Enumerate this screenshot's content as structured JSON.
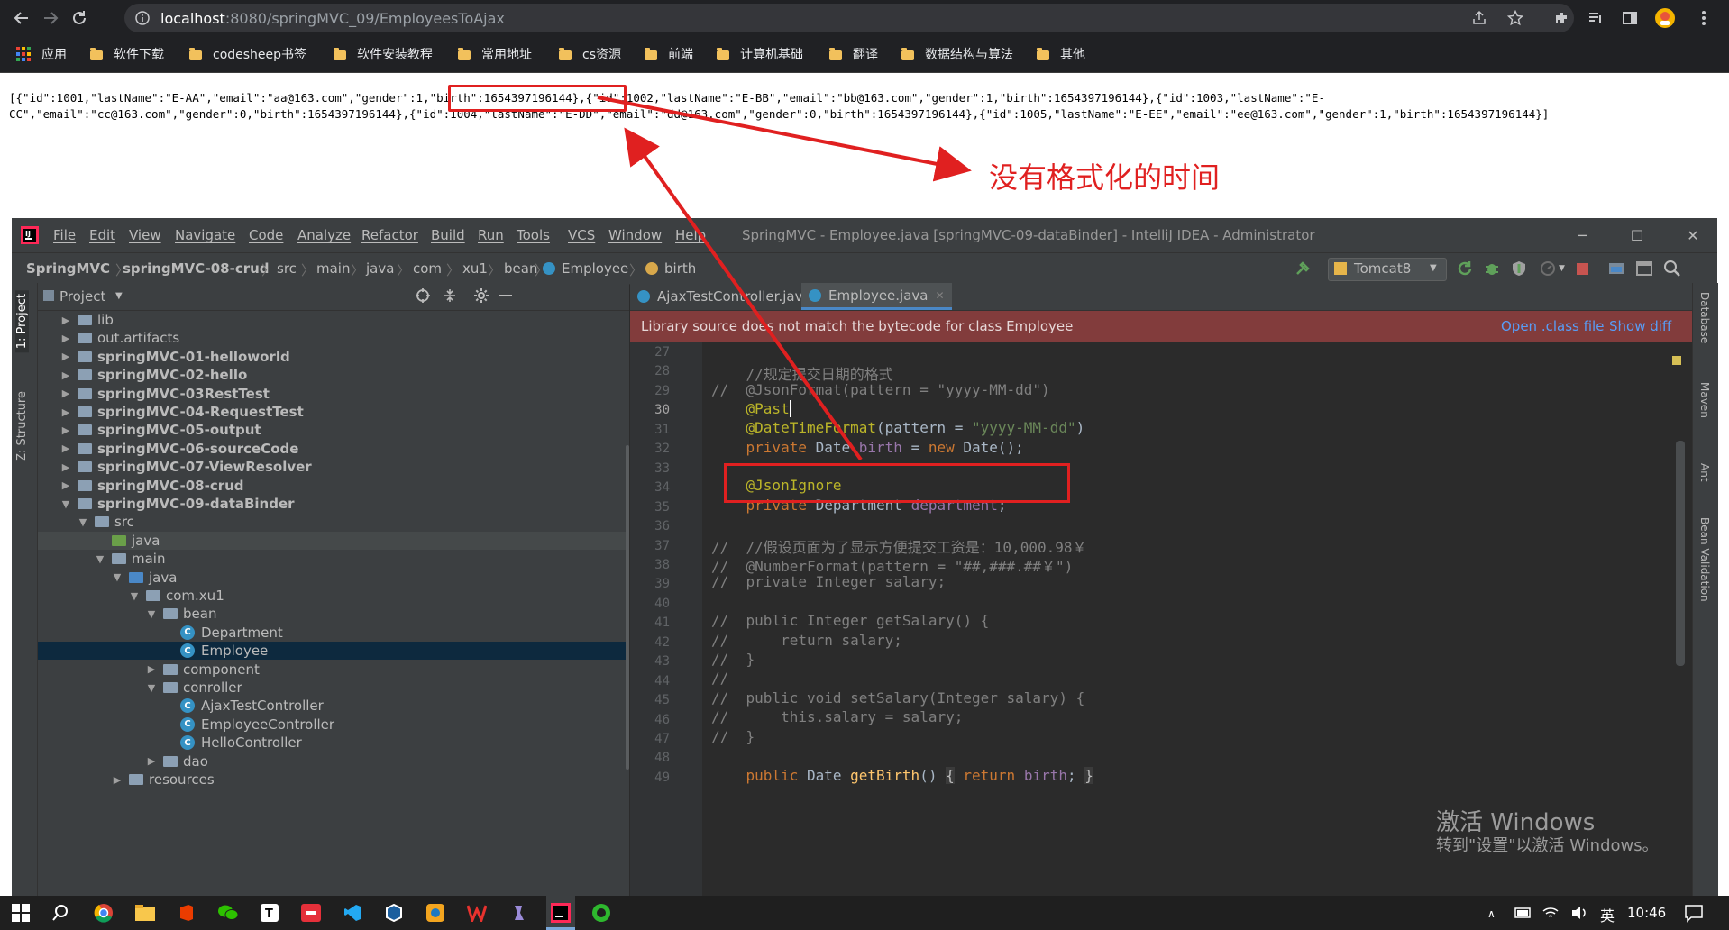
{
  "browser": {
    "url_host": "localhost",
    "url_path": ":8080/springMVC_09/EmployeesToAjax",
    "bookmarks": [
      "应用",
      "软件下载",
      "codesheep书签",
      "软件安装教程",
      "常用地址",
      "cs资源",
      "前端",
      "计算机基础",
      "翻译",
      "数据结构与算法",
      "其他"
    ]
  },
  "json_output": {
    "line1": "[{\"id\":1001,\"lastName\":\"E-AA\",\"email\":\"aa@163.com\",\"gender\":1,\"birth\":1654397196144},{\"id\":1002,\"lastName\":\"E-BB\",\"email\":\"bb@163.com\",\"gender\":1,\"birth\":1654397196144},{\"id\":1003,\"lastName\":\"E-",
    "line2": "CC\",\"email\":\"cc@163.com\",\"gender\":0,\"birth\":1654397196144},{\"id\":1004,\"lastName\":\"E-DD\",\"email\":\"dd@163.com\",\"gender\":0,\"birth\":1654397196144},{\"id\":1005,\"lastName\":\"E-EE\",\"email\":\"ee@163.com\",\"gender\":1,\"birth\":1654397196144}]"
  },
  "annotation": {
    "label": "没有格式化的时间",
    "color": "#e02020"
  },
  "ide": {
    "menu": [
      "File",
      "Edit",
      "View",
      "Navigate",
      "Code",
      "Analyze",
      "Refactor",
      "Build",
      "Run",
      "Tools",
      "VCS",
      "Window",
      "Help"
    ],
    "title": "SpringMVC - Employee.java [springMVC-09-dataBinder] - IntelliJ IDEA - Administrator",
    "breadcrumbs": [
      "SpringMVC",
      "springMVC-08-crud",
      "src",
      "main",
      "java",
      "com",
      "xu1",
      "bean",
      "Employee",
      "birth"
    ],
    "run_config": "Tomcat8",
    "project_label": "Project",
    "left_tabs": [
      "1: Project",
      "Z: Structure"
    ],
    "right_tabs": [
      "Database",
      "Maven",
      "Ant",
      "Bean Validation"
    ],
    "tree": [
      {
        "label": "lib",
        "depth": 0,
        "arrow": "▶",
        "icon": "folder"
      },
      {
        "label": "out.artifacts",
        "depth": 0,
        "arrow": "▶",
        "icon": "folder"
      },
      {
        "label": "springMVC-01-helloworld",
        "depth": 0,
        "arrow": "▶",
        "icon": "folder",
        "bold": true
      },
      {
        "label": "springMVC-02-hello",
        "depth": 0,
        "arrow": "▶",
        "icon": "folder",
        "bold": true
      },
      {
        "label": "springMVC-03RestTest",
        "depth": 0,
        "arrow": "▶",
        "icon": "folder",
        "bold": true
      },
      {
        "label": "springMVC-04-RequestTest",
        "depth": 0,
        "arrow": "▶",
        "icon": "folder",
        "bold": true
      },
      {
        "label": "springMVC-05-output",
        "depth": 0,
        "arrow": "▶",
        "icon": "folder",
        "bold": true
      },
      {
        "label": "springMVC-06-sourceCode",
        "depth": 0,
        "arrow": "▶",
        "icon": "folder",
        "bold": true
      },
      {
        "label": "springMVC-07-ViewResolver",
        "depth": 0,
        "arrow": "▶",
        "icon": "folder",
        "bold": true
      },
      {
        "label": "springMVC-08-crud",
        "depth": 0,
        "arrow": "▶",
        "icon": "folder",
        "bold": true
      },
      {
        "label": "springMVC-09-dataBinder",
        "depth": 0,
        "arrow": "▼",
        "icon": "folder",
        "bold": true
      },
      {
        "label": "src",
        "depth": 1,
        "arrow": "▼",
        "icon": "folder"
      },
      {
        "label": "java",
        "depth": 2,
        "arrow": "",
        "icon": "green",
        "highlight": true
      },
      {
        "label": "main",
        "depth": 2,
        "arrow": "▼",
        "icon": "folder"
      },
      {
        "label": "java",
        "depth": 3,
        "arrow": "▼",
        "icon": "folder-blue"
      },
      {
        "label": "com.xu1",
        "depth": 4,
        "arrow": "▼",
        "icon": "folder"
      },
      {
        "label": "bean",
        "depth": 5,
        "arrow": "▼",
        "icon": "folder"
      },
      {
        "label": "Department",
        "depth": 6,
        "arrow": "",
        "icon": "class"
      },
      {
        "label": "Employee",
        "depth": 6,
        "arrow": "",
        "icon": "class",
        "selected": true
      },
      {
        "label": "component",
        "depth": 5,
        "arrow": "▶",
        "icon": "folder"
      },
      {
        "label": "conroller",
        "depth": 5,
        "arrow": "▼",
        "icon": "folder"
      },
      {
        "label": "AjaxTestController",
        "depth": 6,
        "arrow": "",
        "icon": "class"
      },
      {
        "label": "EmployeeController",
        "depth": 6,
        "arrow": "",
        "icon": "class"
      },
      {
        "label": "HelloController",
        "depth": 6,
        "arrow": "",
        "icon": "class"
      },
      {
        "label": "dao",
        "depth": 5,
        "arrow": "▶",
        "icon": "folder"
      },
      {
        "label": "resources",
        "depth": 3,
        "arrow": "▶",
        "icon": "folder"
      }
    ],
    "tabs": [
      {
        "label": "AjaxTestController.java",
        "active": false
      },
      {
        "label": "Employee.java",
        "active": true
      }
    ],
    "warning": {
      "text": "Library source does not match the bytecode for class Employee",
      "open_class": "Open .class file",
      "show_diff": "Show diff"
    },
    "line_numbers": [
      "27",
      "28",
      "29",
      "30",
      "31",
      "32",
      "33",
      "34",
      "35",
      "36",
      "37",
      "38",
      "39",
      "40",
      "41",
      "42",
      "43",
      "44",
      "45",
      "46",
      "47",
      "48",
      "49"
    ],
    "current_line": "30"
  },
  "watermark": {
    "line1": "激活 Windows",
    "line2": "转到\"设置\"以激活 Windows。"
  },
  "taskbar": {
    "ime": "英",
    "clock": "10:46"
  }
}
